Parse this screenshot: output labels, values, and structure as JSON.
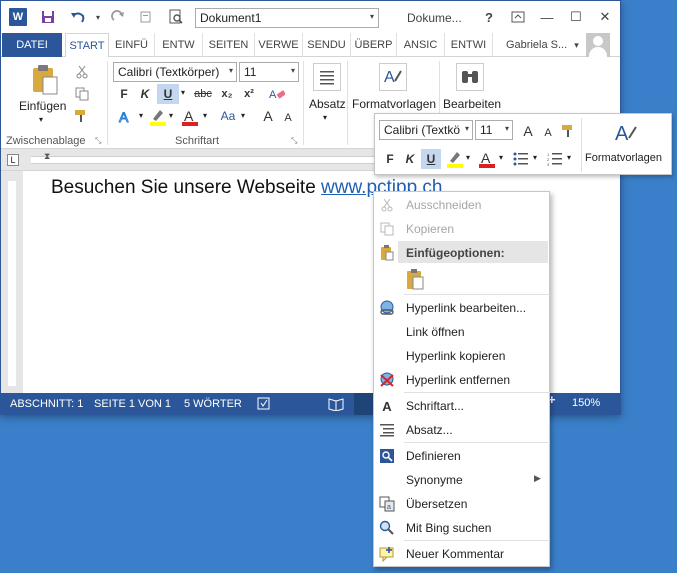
{
  "titlebar": {
    "doc_select_value": "Dokument1",
    "title_text": "Dokume...",
    "help": "?",
    "minimize": "—",
    "maximize": "☐",
    "close": "✕"
  },
  "tabs": {
    "datei": "DATEI",
    "items": [
      "START",
      "EINFÜ",
      "ENTW",
      "SEITEN",
      "VERWE",
      "SENDU",
      "ÜBERP",
      "ANSIC",
      "ENTWI"
    ],
    "user": "Gabriela S...",
    "user_arrow": "▾"
  },
  "ribbon": {
    "paste_label": "Einfügen",
    "clipboard_group": "Zwischenablage",
    "font_name": "Calibri (Textkörper)",
    "font_size": "11",
    "font_group": "Schriftart",
    "bold": "F",
    "italic": "K",
    "underline": "U",
    "strike": "abc",
    "subscript": "x₂",
    "superscript": "x²",
    "grow": "A",
    "shrink": "A",
    "case": "Aa",
    "paragraph_label": "Absatz",
    "styles_label": "Formatvorlagen",
    "editing_label": "Bearbeiten"
  },
  "document": {
    "text_before": "Besuchen Sie unsere Webseite ",
    "link_text": "www.pctipp.ch"
  },
  "statusbar": {
    "section": "ABSCHNITT: 1",
    "page": "SEITE 1 VON 1",
    "words": "5 WÖRTER",
    "zoom": "150%",
    "plus": "+"
  },
  "mini_toolbar": {
    "font_name": "Calibri (Textkö",
    "font_size": "11",
    "bold": "F",
    "italic": "K",
    "underline": "U",
    "styles_label": "Formatvorlagen"
  },
  "context_menu": {
    "cut": "Ausschneiden",
    "copy": "Kopieren",
    "paste_options": "Einfügeoptionen:",
    "edit_hyperlink": "Hyperlink bearbeiten...",
    "open_link": "Link öffnen",
    "copy_hyperlink": "Hyperlink kopieren",
    "remove_hyperlink": "Hyperlink entfernen",
    "font": "Schriftart...",
    "paragraph": "Absatz...",
    "define": "Definieren",
    "synonyms": "Synonyme",
    "translate": "Übersetzen",
    "bing_search": "Mit Bing suchen",
    "new_comment": "Neuer Kommentar"
  },
  "colors": {
    "accent": "#2b579a",
    "highlight_yellow": "#ffff00",
    "font_red": "#e02020",
    "link_blue": "#1f5fb4",
    "desktop": "#3a7fc9"
  }
}
